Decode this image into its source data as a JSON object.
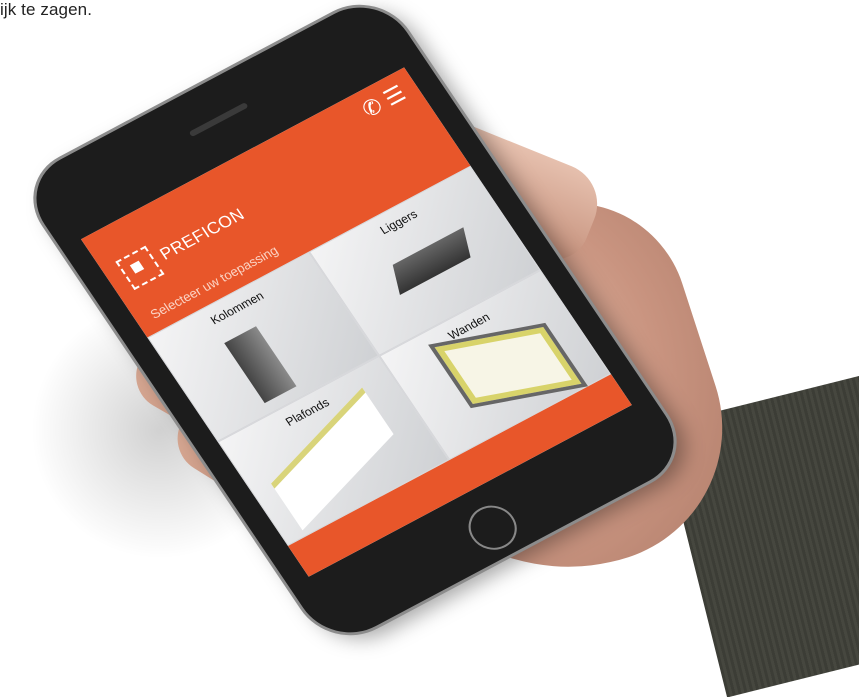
{
  "caption": "ijk te zagen.",
  "app": {
    "brand": "PREFICON",
    "prompt": "Selecteer uw toepassing",
    "tiles": [
      {
        "label": "Kolommen"
      },
      {
        "label": "Liggers"
      },
      {
        "label": "Plafonds"
      },
      {
        "label": "Wanden"
      }
    ],
    "icons": {
      "phone": "phone-icon",
      "menu": "menu-icon"
    },
    "colors": {
      "accent": "#e8562a"
    }
  }
}
